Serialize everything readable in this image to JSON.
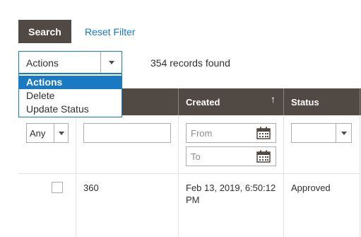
{
  "toolbar": {
    "search_label": "Search",
    "reset_filter_label": "Reset Filter"
  },
  "actions": {
    "selected": "Actions",
    "options": [
      "Actions",
      "Delete",
      "Update Status"
    ]
  },
  "records": {
    "count": "354",
    "suffix": "records found"
  },
  "grid": {
    "columns": [
      "",
      "",
      "Created",
      "Status"
    ],
    "sort": {
      "column": "Created",
      "direction": "ascending"
    }
  },
  "filters": {
    "any_value": "Any",
    "id_value": "",
    "created_from_placeholder": "From",
    "created_to_placeholder": "To",
    "status_value": ""
  },
  "rows": [
    {
      "id": "360",
      "created": "Feb 13, 2019, 6:50:12 PM",
      "status": "Approved"
    }
  ],
  "icons": {
    "calendar": "calendar-icon",
    "dropdown": "chevron-down-icon",
    "sort": "sort-arrow-up-icon"
  },
  "colors": {
    "header_bg": "#514943",
    "accent": "#1979c3",
    "border": "#adadad"
  }
}
